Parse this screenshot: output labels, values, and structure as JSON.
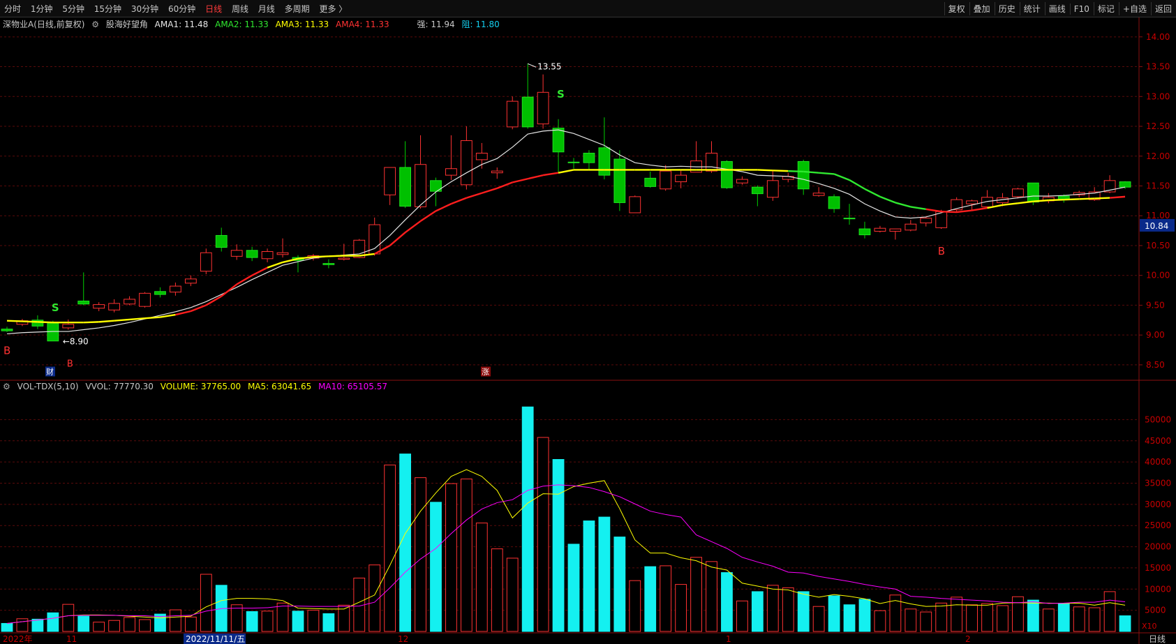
{
  "toolbar": {
    "periods": [
      "分时",
      "1分钟",
      "5分钟",
      "15分钟",
      "30分钟",
      "60分钟",
      "日线",
      "周线",
      "月线",
      "多周期",
      "更多 〉"
    ],
    "active_period": "日线",
    "right": [
      "复权",
      "叠加",
      "历史",
      "统计",
      "画线",
      "F10",
      "标记",
      "+自选",
      "返回"
    ]
  },
  "main_legend": {
    "title": "深物业A(日线,前复权)",
    "indicator": "股海好望角",
    "ama1": "AMA1: 11.48",
    "ama2": "AMA2: 11.33",
    "ama3": "AMA3: 11.33",
    "ama4": "AMA4: 11.33",
    "strong": "强: 11.94",
    "resist": "阻: 11.80"
  },
  "vol_legend": {
    "name": "VOL-TDX(5,10)",
    "vvol": "VVOL: 77770.30",
    "volume": "VOLUME: 37765.00",
    "ma5": "MA5: 63041.65",
    "ma10": "MA10: 65105.57"
  },
  "colors": {
    "up": "#ff3232",
    "down": "#00c000",
    "vol_down": "#14f0f0",
    "ama_white": "#e6e6e6",
    "ama_yellow": "#ffff00",
    "ama_red": "#ff1e1e",
    "ama_green": "#30e830",
    "ma5": "#ffff00",
    "ma10": "#ff00ff"
  },
  "chart_data": [
    {
      "type": "candlestick",
      "title": "深物业A(日线,前复权)",
      "ylim": [
        8.3,
        14.15
      ],
      "y_ticks": [
        "14.00",
        "13.50",
        "13.00",
        "12.50",
        "12.00",
        "11.50",
        "11.00",
        "10.50",
        "10.00",
        "9.50",
        "9.00",
        "8.50"
      ],
      "current_price": "10.84",
      "annotations": {
        "high": "13.55",
        "low": "8.90",
        "sell": "S",
        "buy": "B",
        "fin": "财",
        "rise": "涨"
      },
      "candles": [
        [
          9.1,
          9.07,
          9.14,
          9.05
        ],
        [
          9.18,
          9.24,
          9.27,
          9.15
        ],
        [
          9.25,
          9.15,
          9.33,
          9.1
        ],
        [
          9.2,
          8.9,
          9.24,
          8.9
        ],
        [
          9.12,
          9.18,
          9.26,
          9.09
        ],
        [
          9.57,
          9.52,
          10.05,
          9.5
        ],
        [
          9.45,
          9.51,
          9.55,
          9.4
        ],
        [
          9.42,
          9.53,
          9.6,
          9.38
        ],
        [
          9.52,
          9.6,
          9.65,
          9.5
        ],
        [
          9.48,
          9.7,
          9.72,
          9.46
        ],
        [
          9.73,
          9.68,
          9.8,
          9.63
        ],
        [
          9.72,
          9.82,
          9.88,
          9.66
        ],
        [
          9.87,
          9.94,
          10.0,
          9.82
        ],
        [
          10.07,
          10.38,
          10.45,
          10.02
        ],
        [
          10.67,
          10.47,
          10.8,
          10.4
        ],
        [
          10.32,
          10.42,
          10.52,
          10.26
        ],
        [
          10.42,
          10.3,
          10.48,
          10.24
        ],
        [
          10.28,
          10.4,
          10.45,
          10.22
        ],
        [
          10.35,
          10.38,
          10.62,
          10.3
        ],
        [
          10.3,
          10.25,
          10.34,
          10.05
        ],
        [
          10.29,
          10.33,
          10.36,
          10.25
        ],
        [
          10.2,
          10.18,
          10.27,
          10.12
        ],
        [
          10.27,
          10.29,
          10.53,
          10.25
        ],
        [
          10.3,
          10.59,
          10.61,
          10.29
        ],
        [
          10.36,
          10.85,
          10.97,
          10.33
        ],
        [
          11.35,
          11.81,
          11.81,
          11.18
        ],
        [
          11.81,
          11.16,
          12.25,
          11.13
        ],
        [
          11.15,
          11.86,
          12.35,
          11.12
        ],
        [
          11.59,
          11.41,
          11.64,
          11.16
        ],
        [
          11.68,
          11.79,
          12.35,
          11.6
        ],
        [
          11.52,
          12.26,
          12.5,
          11.44
        ],
        [
          11.94,
          12.05,
          12.22,
          11.79
        ],
        [
          11.72,
          11.75,
          11.81,
          11.62
        ],
        [
          12.49,
          12.92,
          13.0,
          12.45
        ],
        [
          12.99,
          12.49,
          13.55,
          12.46
        ],
        [
          12.54,
          13.07,
          13.37,
          12.46
        ],
        [
          12.47,
          12.07,
          12.62,
          11.73
        ],
        [
          11.9,
          11.89,
          11.97,
          11.79
        ],
        [
          12.05,
          11.89,
          12.1,
          11.78
        ],
        [
          12.14,
          11.68,
          12.65,
          11.61
        ],
        [
          11.95,
          11.22,
          12.1,
          11.08
        ],
        [
          11.05,
          11.32,
          11.34,
          11.05
        ],
        [
          11.63,
          11.49,
          11.74,
          11.47
        ],
        [
          11.45,
          11.75,
          11.85,
          11.42
        ],
        [
          11.57,
          11.68,
          11.76,
          11.46
        ],
        [
          11.73,
          11.92,
          12.25,
          11.73
        ],
        [
          11.75,
          12.05,
          12.25,
          11.72
        ],
        [
          11.91,
          11.47,
          11.93,
          11.45
        ],
        [
          11.55,
          11.61,
          11.66,
          11.52
        ],
        [
          11.48,
          11.37,
          11.51,
          11.16
        ],
        [
          11.31,
          11.59,
          11.77,
          11.25
        ],
        [
          11.61,
          11.66,
          11.72,
          11.56
        ],
        [
          11.91,
          11.45,
          11.94,
          11.35
        ],
        [
          11.34,
          11.38,
          11.48,
          11.32
        ],
        [
          11.32,
          11.12,
          11.36,
          11.05
        ],
        [
          10.96,
          10.95,
          11.2,
          10.85
        ],
        [
          10.78,
          10.68,
          10.9,
          10.62
        ],
        [
          10.74,
          10.79,
          10.83,
          10.72
        ],
        [
          10.74,
          10.78,
          10.78,
          10.6
        ],
        [
          10.76,
          10.86,
          10.93,
          10.74
        ],
        [
          10.88,
          10.96,
          10.98,
          10.82
        ],
        [
          10.8,
          11.07,
          11.1,
          10.78
        ],
        [
          11.1,
          11.27,
          11.31,
          11.05
        ],
        [
          11.2,
          11.25,
          11.27,
          11.1
        ],
        [
          11.15,
          11.31,
          11.43,
          11.13
        ],
        [
          11.22,
          11.3,
          11.38,
          11.16
        ],
        [
          11.32,
          11.45,
          11.47,
          11.29
        ],
        [
          11.55,
          11.23,
          11.55,
          11.18
        ],
        [
          11.25,
          11.31,
          11.38,
          11.21
        ],
        [
          11.33,
          11.28,
          11.36,
          11.22
        ],
        [
          11.35,
          11.39,
          11.42,
          11.31
        ],
        [
          11.27,
          11.4,
          11.48,
          11.25
        ],
        [
          11.4,
          11.59,
          11.68,
          11.38
        ],
        [
          11.57,
          11.48,
          11.58,
          11.45
        ]
      ],
      "ama_white": [
        9.02,
        9.04,
        9.05,
        9.06,
        9.06,
        9.09,
        9.12,
        9.16,
        9.21,
        9.27,
        9.33,
        9.39,
        9.46,
        9.56,
        9.68,
        9.8,
        9.93,
        10.05,
        10.17,
        10.23,
        10.29,
        10.32,
        10.34,
        10.36,
        10.45,
        10.67,
        10.93,
        11.18,
        11.4,
        11.57,
        11.72,
        11.86,
        11.96,
        12.15,
        12.37,
        12.42,
        12.44,
        12.38,
        12.28,
        12.18,
        12.02,
        11.89,
        11.85,
        11.82,
        11.83,
        11.82,
        11.82,
        11.78,
        11.74,
        11.68,
        11.67,
        11.66,
        11.61,
        11.54,
        11.46,
        11.36,
        11.2,
        11.08,
        10.98,
        10.96,
        10.98,
        11.05,
        11.12,
        11.18,
        11.24,
        11.27,
        11.3,
        11.33,
        11.33,
        11.34,
        11.36,
        11.38,
        11.43,
        11.48
      ],
      "ama_main": [
        9.24,
        9.23,
        9.22,
        9.21,
        9.21,
        9.21,
        9.22,
        9.24,
        9.26,
        9.28,
        9.3,
        9.34,
        9.4,
        9.5,
        9.65,
        9.85,
        10.0,
        10.13,
        10.22,
        10.28,
        10.31,
        10.32,
        10.33,
        10.33,
        10.36,
        10.5,
        10.72,
        10.91,
        11.08,
        11.2,
        11.3,
        11.38,
        11.46,
        11.56,
        11.62,
        11.68,
        11.72,
        11.77,
        11.77,
        11.77,
        11.77,
        11.77,
        11.77,
        11.77,
        11.77,
        11.77,
        11.77,
        11.77,
        11.77,
        11.77,
        11.76,
        11.75,
        11.74,
        11.72,
        11.7,
        11.6,
        11.45,
        11.32,
        11.22,
        11.15,
        11.11,
        11.07,
        11.06,
        11.09,
        11.13,
        11.18,
        11.21,
        11.24,
        11.26,
        11.27,
        11.28,
        11.29,
        11.3,
        11.32
      ],
      "ama_main_colors": [
        "y",
        "y",
        "y",
        "y",
        "y",
        "y",
        "y",
        "y",
        "y",
        "y",
        "y",
        "r",
        "r",
        "r",
        "r",
        "r",
        "r",
        "y",
        "y",
        "y",
        "y",
        "y",
        "y",
        "y",
        "r",
        "r",
        "r",
        "r",
        "r",
        "r",
        "r",
        "r",
        "r",
        "r",
        "r",
        "r",
        "y",
        "y",
        "y",
        "y",
        "y",
        "y",
        "y",
        "y",
        "y",
        "y",
        "y",
        "y",
        "y",
        "y",
        "y",
        "g",
        "g",
        "g",
        "g",
        "g",
        "g",
        "g",
        "g",
        "g",
        "r",
        "r",
        "r",
        "r",
        "y",
        "y",
        "y",
        "y",
        "y",
        "y",
        "y",
        "y",
        "r",
        "r"
      ]
    },
    {
      "type": "bar",
      "title": "VOL-TDX(5,10)",
      "ylim": [
        0,
        56000
      ],
      "y_ticks": [
        "50000",
        "45000",
        "40000",
        "35000",
        "30000",
        "25000",
        "20000",
        "15000",
        "10000",
        "5000"
      ],
      "unit": "X10",
      "values": [
        1900,
        3000,
        2900,
        4400,
        6400,
        3600,
        2200,
        2600,
        3300,
        2800,
        4100,
        5100,
        3400,
        13500,
        10900,
        6300,
        4700,
        4800,
        6700,
        4800,
        5000,
        4200,
        6200,
        12600,
        15700,
        39300,
        41900,
        36300,
        30500,
        34900,
        36000,
        25600,
        19500,
        17300,
        53000,
        45800,
        40600,
        20600,
        26100,
        27000,
        22300,
        12000,
        15300,
        15500,
        11100,
        17500,
        16500,
        13900,
        7200,
        9400,
        10900,
        10300,
        9400,
        5900,
        8400,
        6300,
        7600,
        4900,
        8600,
        5300,
        4600,
        6700,
        8100,
        6300,
        6600,
        6100,
        8200,
        7400,
        5300,
        6600,
        5800,
        5600,
        9400,
        3700
      ],
      "ma5": [
        1900,
        2300,
        2700,
        3100,
        3700,
        3900,
        3900,
        3800,
        3600,
        3400,
        3200,
        3400,
        3600,
        5800,
        7300,
        7800,
        7800,
        7700,
        7300,
        5500,
        5400,
        5300,
        5300,
        6900,
        8600,
        15600,
        23100,
        28400,
        32700,
        36600,
        38200,
        36600,
        33300,
        26800,
        30300,
        32500,
        32400,
        34200,
        35000,
        35600,
        29000,
        21600,
        18500,
        18500,
        17400,
        16700,
        15200,
        14500,
        11400,
        10700,
        10000,
        9800,
        8800,
        8100,
        8700,
        8300,
        7700,
        6600,
        7300,
        6500,
        5900,
        6000,
        6300,
        6200,
        6200,
        6700,
        6800,
        6700,
        6700,
        6600,
        6700,
        6200,
        6800,
        6200
      ],
      "ma10": [
        1900,
        2300,
        2700,
        3100,
        3700,
        3800,
        3800,
        3800,
        3700,
        3700,
        3500,
        3700,
        3800,
        4800,
        5400,
        5500,
        5500,
        5600,
        6000,
        6000,
        5900,
        5900,
        5900,
        6000,
        6900,
        10300,
        14000,
        17100,
        19600,
        23100,
        26300,
        28900,
        30400,
        31100,
        33300,
        34300,
        34600,
        34400,
        34000,
        33000,
        31800,
        30100,
        28400,
        27600,
        27000,
        22800,
        21200,
        19600,
        17500,
        16400,
        15400,
        14000,
        13800,
        13000,
        12400,
        11800,
        11100,
        10500,
        10000,
        8300,
        8100,
        7800,
        7600,
        7400,
        7200,
        6900,
        6800,
        7000,
        6600,
        6700,
        6900,
        6900,
        7400,
        7000
      ]
    }
  ],
  "time_axis": {
    "year": "2022年",
    "nov": "11",
    "selected_date": "2022/11/11/五",
    "dec": "12",
    "jan": "1",
    "feb": "2",
    "period_label": "日线"
  }
}
